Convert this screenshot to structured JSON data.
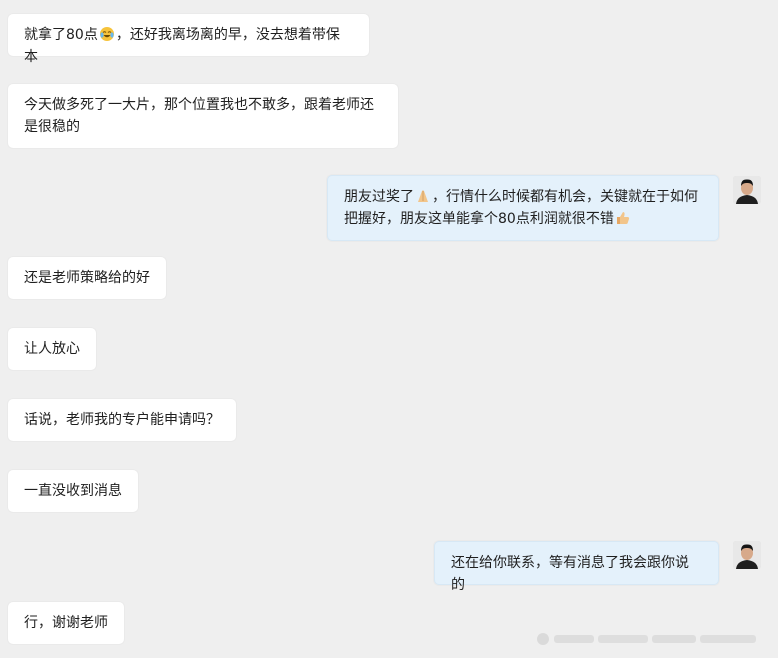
{
  "messages": [
    {
      "side": "left",
      "text": "就拿了80点😂，还好我离场离的早，没去想着带保本"
    },
    {
      "side": "left",
      "text": "今天做多死了一大片，那个位置我也不敢多，跟着老师还是很稳的"
    },
    {
      "side": "right",
      "text_a": "朋友过奖了",
      "text_b": "，行情什么时候都有机会，关键就在于如何把握好，朋友这单能拿个80点利润就很不错"
    },
    {
      "side": "left",
      "text": "还是老师策略给的好"
    },
    {
      "side": "left",
      "text": "让人放心"
    },
    {
      "side": "left",
      "text": "话说，老师我的专户能申请吗？"
    },
    {
      "side": "left",
      "text": "一直没收到消息"
    },
    {
      "side": "right",
      "text": "还在给你联系，等有消息了我会跟你说的"
    },
    {
      "side": "left",
      "text": "行，谢谢老师"
    }
  ],
  "emojis": {
    "laugh": "laugh-with-tears-icon",
    "pray": "folded-hands-icon",
    "thumb": "thumbs-up-icon"
  },
  "colors": {
    "background": "#efefef",
    "left_bubble": "#ffffff",
    "right_bubble": "#e4f1fb"
  }
}
